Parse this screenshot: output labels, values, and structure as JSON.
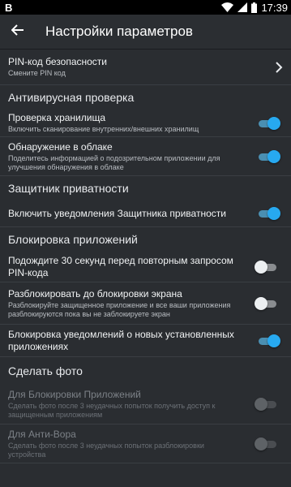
{
  "status_bar": {
    "left_label": "B",
    "time": "17:39",
    "icons": [
      "wifi-icon",
      "signal-icon",
      "battery-icon"
    ]
  },
  "app_bar": {
    "title": "Настройки параметров",
    "back_icon": "arrow-left-icon"
  },
  "pin": {
    "title": "PIN-код безопасности",
    "subtitle": "Смените PIN код"
  },
  "sections": {
    "antivirus": "Антивирусная проверка",
    "privacy": "Защитник приватности",
    "app_lock": "Блокировка приложений",
    "photo": "Сделать фото"
  },
  "items": {
    "storage": {
      "title": "Проверка хранилища",
      "subtitle": "Включить сканирование внутренних/внешних хранилищ",
      "enabled": true
    },
    "cloud": {
      "title": "Обнаружение в облаке",
      "subtitle": "Поделитесь информацией о подозрительном приложении для улучшения обнаружения в облаке",
      "enabled": true
    },
    "privacy_notify": {
      "title": "Включить уведомления Защитника приватности",
      "enabled": true
    },
    "wait30": {
      "title": "Подождите 30 секунд перед повторным запросом PIN-кода",
      "enabled": false
    },
    "unlock_until": {
      "title": "Разблокировать до блокировки экрана",
      "subtitle": "Разблокируйте защищенное приложение и все ваши приложения разблокируются пока вы не заблокируете экран",
      "enabled": false
    },
    "notify_new_apps": {
      "title": "Блокировка уведомлений о новых установленных приложениях",
      "enabled": true
    },
    "photo_app_lock": {
      "title": "Для Блокировки Приложений",
      "subtitle": "Сделать фото после 3 неудачных попыток получить доступ к защищенным приложениям",
      "enabled": false
    },
    "photo_anti_theft": {
      "title": "Для Анти-Вора",
      "subtitle": "Сделать фото после 3 неудачных попыток разблокировки устройства",
      "enabled": false
    }
  },
  "colors": {
    "background": "#2a2d31",
    "accent": "#27a9f0"
  }
}
